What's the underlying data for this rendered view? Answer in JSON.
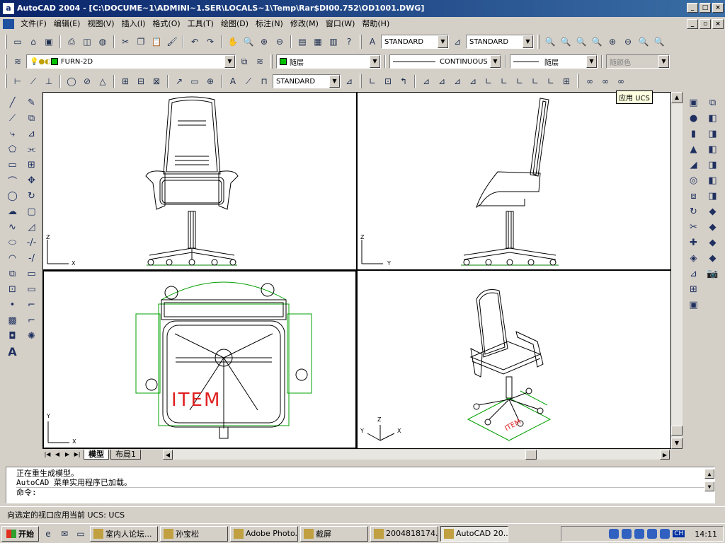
{
  "window": {
    "title": "AutoCAD 2004 - [C:\\DOCUME~1\\ADMINI~1.SER\\LOCALS~1\\Temp\\Rar$DI00.752\\OD1001.DWG]"
  },
  "menu": [
    "文件(F)",
    "编辑(E)",
    "视图(V)",
    "插入(I)",
    "格式(O)",
    "工具(T)",
    "绘图(D)",
    "标注(N)",
    "修改(M)",
    "窗口(W)",
    "帮助(H)"
  ],
  "toolbars": {
    "text_style": "STANDARD",
    "dim_style": "STANDARD",
    "layer": "FURN-2D",
    "color": "随层",
    "linetype": "CONTINUOUS",
    "lineweight": "随层",
    "plotstyle": "随颜色",
    "dim_style2": "STANDARD"
  },
  "tooltip": "应用 UCS",
  "viewports": {
    "front": {
      "axis_y": "Z",
      "axis_x": "X"
    },
    "side": {
      "axis_y": "Z",
      "axis_x": "Y"
    },
    "top": {
      "axis_y": "Y",
      "axis_x": "X",
      "label": "ITEM"
    },
    "iso": {
      "axis_z": "Z",
      "axis_y": "Y",
      "axis_x": "X",
      "label": "ITEM"
    }
  },
  "tabs": [
    "模型",
    "布局1"
  ],
  "command_lines": [
    "正在重生成模型。",
    "AutoCAD 菜单实用程序已加载。",
    "命令:"
  ],
  "status_text": "向选定的视口应用当前 UCS:  UCS",
  "taskbar": {
    "start": "开始",
    "tasks": [
      "室内人论坛...",
      "孙宝松",
      "Adobe Photo...",
      "截屏",
      "2004818174...",
      "AutoCAD 20..."
    ],
    "clock": "14:11",
    "ime": "CH"
  }
}
